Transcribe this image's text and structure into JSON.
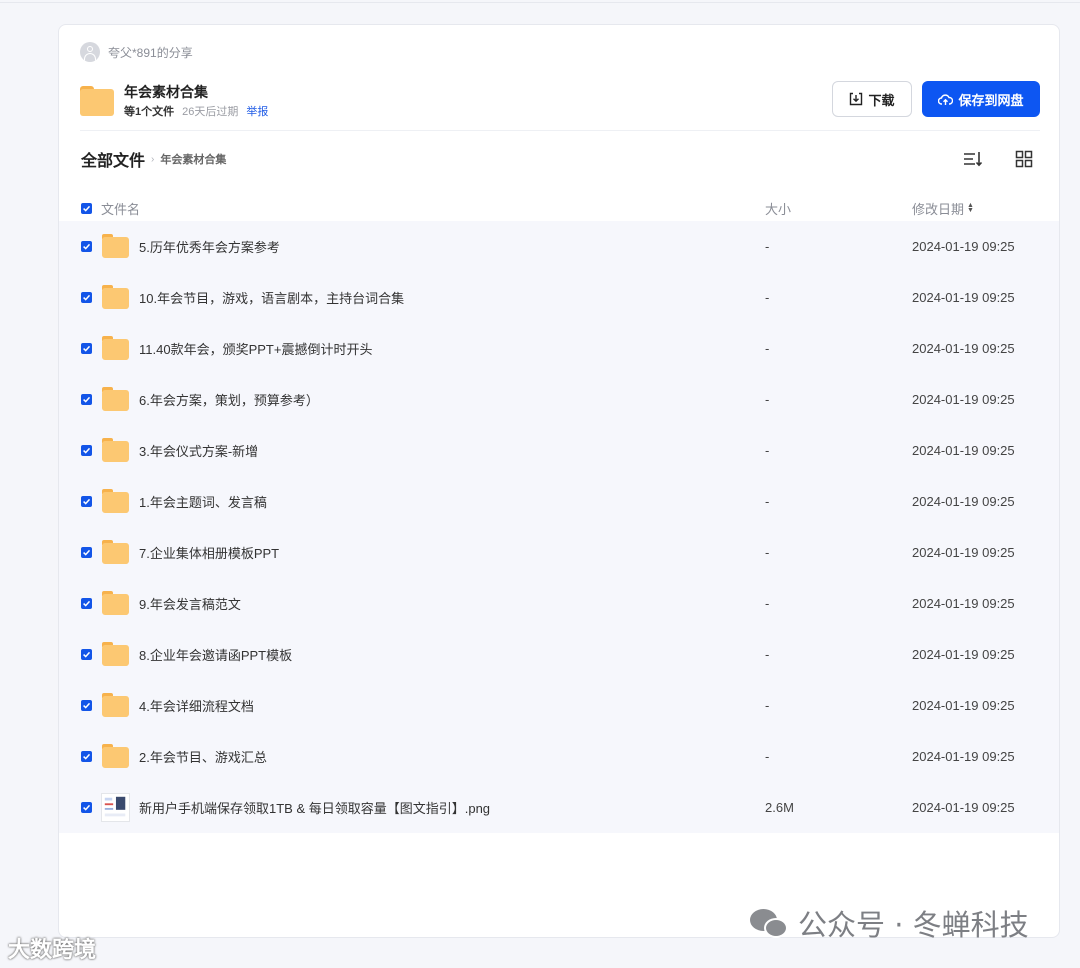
{
  "share": {
    "sharer": "夸父*891的分享",
    "title": "年会素材合集",
    "file_count": "等1个文件",
    "expire": "26天后过期",
    "report": "举报",
    "download_label": "下载",
    "save_label": "保存到网盘"
  },
  "breadcrumb": {
    "root": "全部文件",
    "separator": "›",
    "current": "年会素材合集"
  },
  "columns": {
    "name": "文件名",
    "size": "大小",
    "date": "修改日期"
  },
  "files": [
    {
      "name": "5.历年优秀年会方案参考",
      "size": "-",
      "date": "2024-01-19 09:25",
      "type": "folder"
    },
    {
      "name": "10.年会节目，游戏，语言剧本，主持台词合集",
      "size": "-",
      "date": "2024-01-19 09:25",
      "type": "folder"
    },
    {
      "name": "11.40款年会，颁奖PPT+震撼倒计时开头",
      "size": "-",
      "date": "2024-01-19 09:25",
      "type": "folder"
    },
    {
      "name": "6.年会方案，策划，预算参考）",
      "size": "-",
      "date": "2024-01-19 09:25",
      "type": "folder"
    },
    {
      "name": "3.年会仪式方案-新增",
      "size": "-",
      "date": "2024-01-19 09:25",
      "type": "folder"
    },
    {
      "name": "1.年会主题词、发言稿",
      "size": "-",
      "date": "2024-01-19 09:25",
      "type": "folder"
    },
    {
      "name": "7.企业集体相册模板PPT",
      "size": "-",
      "date": "2024-01-19 09:25",
      "type": "folder"
    },
    {
      "name": "9.年会发言稿范文",
      "size": "-",
      "date": "2024-01-19 09:25",
      "type": "folder"
    },
    {
      "name": "8.企业年会邀请函PPT模板",
      "size": "-",
      "date": "2024-01-19 09:25",
      "type": "folder"
    },
    {
      "name": "4.年会详细流程文档",
      "size": "-",
      "date": "2024-01-19 09:25",
      "type": "folder"
    },
    {
      "name": "2.年会节目、游戏汇总",
      "size": "-",
      "date": "2024-01-19 09:25",
      "type": "folder"
    },
    {
      "name": "新用户手机端保存领取1TB & 每日领取容量【图文指引】.png",
      "size": "2.6M",
      "date": "2024-01-19 09:25",
      "type": "image"
    }
  ],
  "watermarks": {
    "right": "公众号 · 冬蝉科技",
    "left": "大数跨境"
  },
  "colors": {
    "primary": "#0d56f2",
    "folder": "#fcc872",
    "row_bg": "#f6f7fc"
  }
}
